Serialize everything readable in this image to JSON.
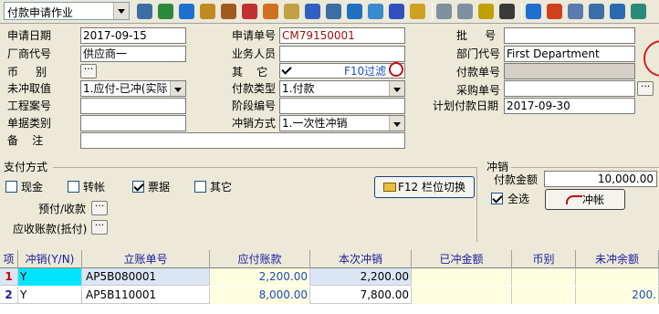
{
  "toolbar": {
    "doc_type_selected": "付款申请作业",
    "icons": [
      "report-icon",
      "tree-icon",
      "refresh-icon",
      "lock-icon",
      "briefcase-icon",
      "hat-icon",
      "people-icon",
      "folder-open-icon",
      "download-icon",
      "key-icon",
      "help-icon",
      "card-icon",
      "cart-icon",
      "dollar-icon",
      "copy-icon",
      "copy2-icon",
      "save-icon",
      "note-icon",
      "check-icon",
      "flag-icon",
      "edit-icon",
      "pin-icon",
      "network-icon",
      "table-icon"
    ]
  },
  "form": {
    "apply_date_label": "申请日期",
    "apply_date": "2017-09-15",
    "apply_no_label": "申请单号",
    "apply_no": "CM79150001",
    "approval_label": "批     号",
    "approval_no": "",
    "vendor_label": "厂商代号",
    "vendor": "供应商一",
    "salesperson_label": "业务人员",
    "salesperson": "",
    "dept_label": "部门代号",
    "dept": "First Department",
    "currency_label": "币     别",
    "currency": "",
    "other_label": "其    它",
    "f10_label": "F10过滤",
    "payment_no_label": "付款单号",
    "payment_no": "",
    "unoffset_label": "未冲取值",
    "unoffset": "1.应付-已冲(实际",
    "pay_type_label": "付款类型",
    "pay_type": "1.付款",
    "purchase_no_label": "采购单号",
    "purchase_no": "",
    "project_label": "工程案号",
    "project": "",
    "stage_label": "阶段编号",
    "stage": "",
    "plan_date_label": "计划付款日期",
    "plan_date": "2017-09-30",
    "doc_class_label": "单据类别",
    "doc_class": "",
    "offset_method_label": "冲销方式",
    "offset_method": "1.一次性冲销",
    "remark_label": "备    注",
    "remark": ""
  },
  "payment": {
    "group_label": "支付方式",
    "cash": "现金",
    "transfer": "转帐",
    "bill": "票据",
    "other": "其它",
    "prepaid_label": "预付/收款",
    "receivable_label": "应收账款(抵付)",
    "f12_button": "F12 栏位切换"
  },
  "offset": {
    "group_label": "冲销",
    "amount_label": "付款金额",
    "amount": "10,000.00",
    "select_all": "全选",
    "offset_button": "冲帐"
  },
  "grid": {
    "headers": [
      "项",
      "冲销(Y/N)",
      "立账单号",
      "应付账款",
      "本次冲销",
      "已冲金额",
      "币别",
      "未冲余额"
    ],
    "rows": [
      {
        "idx": "1",
        "yn": "Y",
        "no": "AP5B080001",
        "payable": "2,200.00",
        "this": "2,200.00",
        "done": "",
        "cur": "",
        "remain": ""
      },
      {
        "idx": "2",
        "yn": "Y",
        "no": "AP5B110001",
        "payable": "8,000.00",
        "this": "7,800.00",
        "done": "",
        "cur": "",
        "remain": "200."
      }
    ]
  }
}
